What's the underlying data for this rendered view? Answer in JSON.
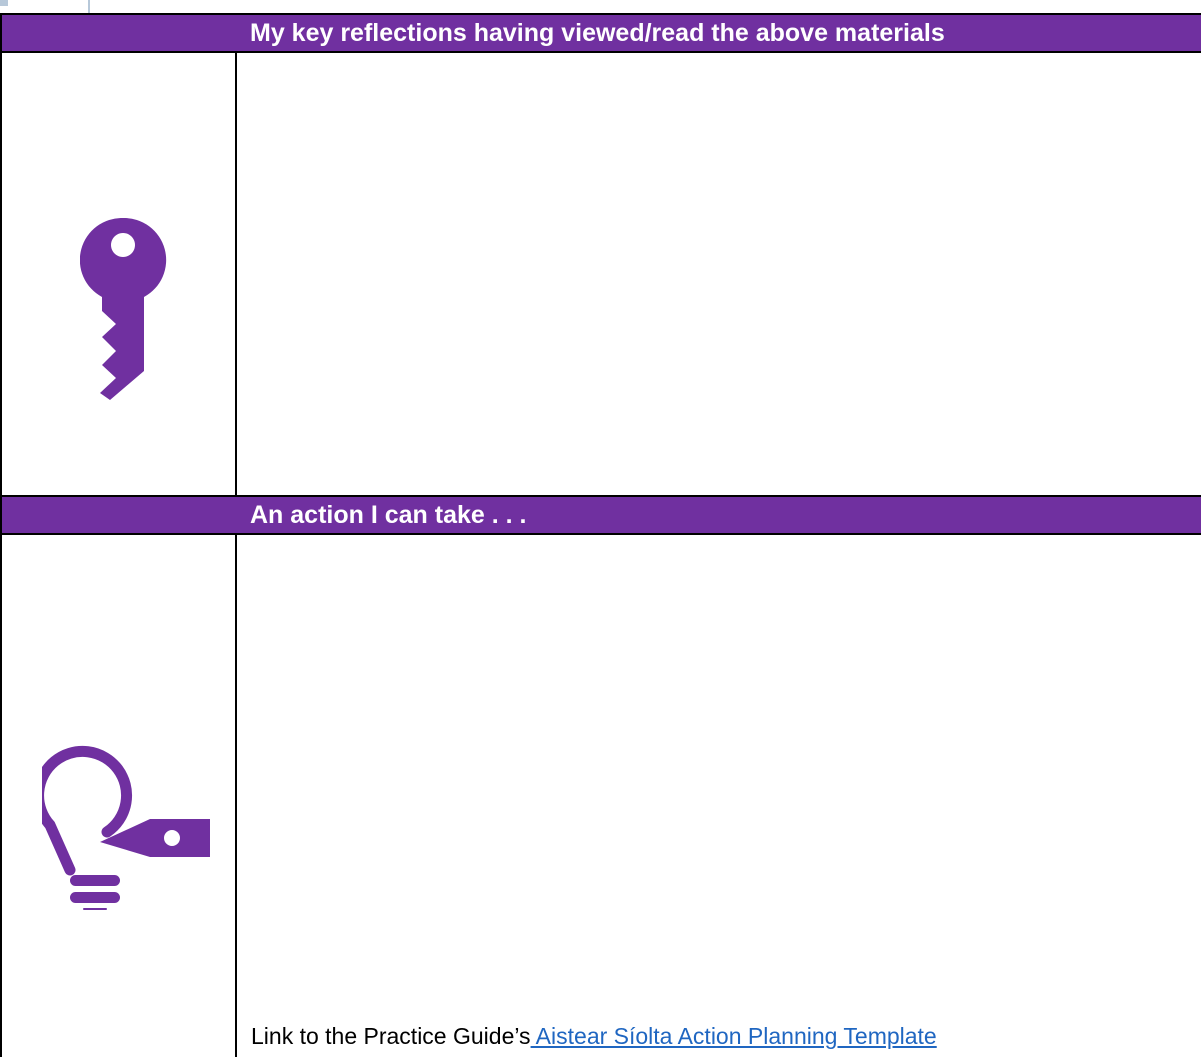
{
  "sections": {
    "reflections": {
      "title": "My key reflections having viewed/read the above materials",
      "icon": "key-icon",
      "notes": ""
    },
    "action": {
      "title": "An action I can take . . .",
      "icon": "lightbulb-key-icon",
      "notes": "",
      "link_prefix": "Link to the Practice Guide’s",
      "link_text": " Aistear Síolta Action Planning Template"
    }
  },
  "colors": {
    "header_bg": "#7030a0",
    "header_text": "#ffffff",
    "icon": "#7030a0",
    "link": "#1f66c1",
    "border": "#000000"
  }
}
